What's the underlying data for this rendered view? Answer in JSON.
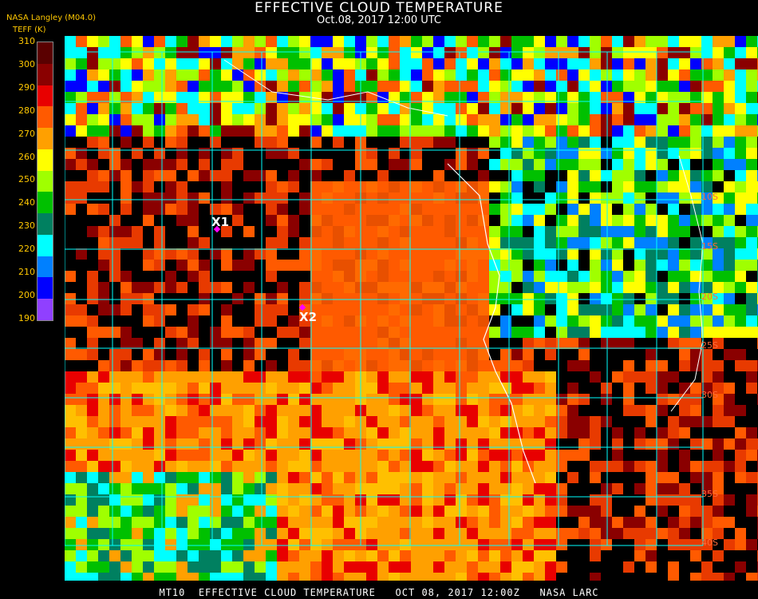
{
  "header": {
    "title": "EFFECTIVE CLOUD TEMPERATURE",
    "subtitle": "Oct.08, 2017 12:00 UTC",
    "agency": "NASA Langley (M04.0)",
    "units": "TEFF (K)"
  },
  "legend": {
    "ticks": [
      "310",
      "300",
      "290",
      "280",
      "270",
      "260",
      "250",
      "240",
      "230",
      "220",
      "210",
      "200",
      "190"
    ],
    "colors": [
      "#5a0000",
      "#8a0000",
      "#e80000",
      "#ff5a00",
      "#ffa000",
      "#ffff00",
      "#a0ff00",
      "#00c000",
      "#008060",
      "#00ffff",
      "#0080ff",
      "#0000ff",
      "#9040ff"
    ]
  },
  "markers": [
    {
      "label": "X1",
      "color": "#ff00ff"
    },
    {
      "label": "X2",
      "color": "#ff00ff"
    }
  ],
  "grid": {
    "color": "#00ffff",
    "labels": [
      "10S",
      "15S",
      "20S",
      "25S",
      "30S",
      "35S",
      "40S"
    ]
  },
  "footer": {
    "text": "MT10  EFFECTIVE CLOUD TEMPERATURE   OCT 08, 2017 12:00Z   NASA LARC"
  }
}
